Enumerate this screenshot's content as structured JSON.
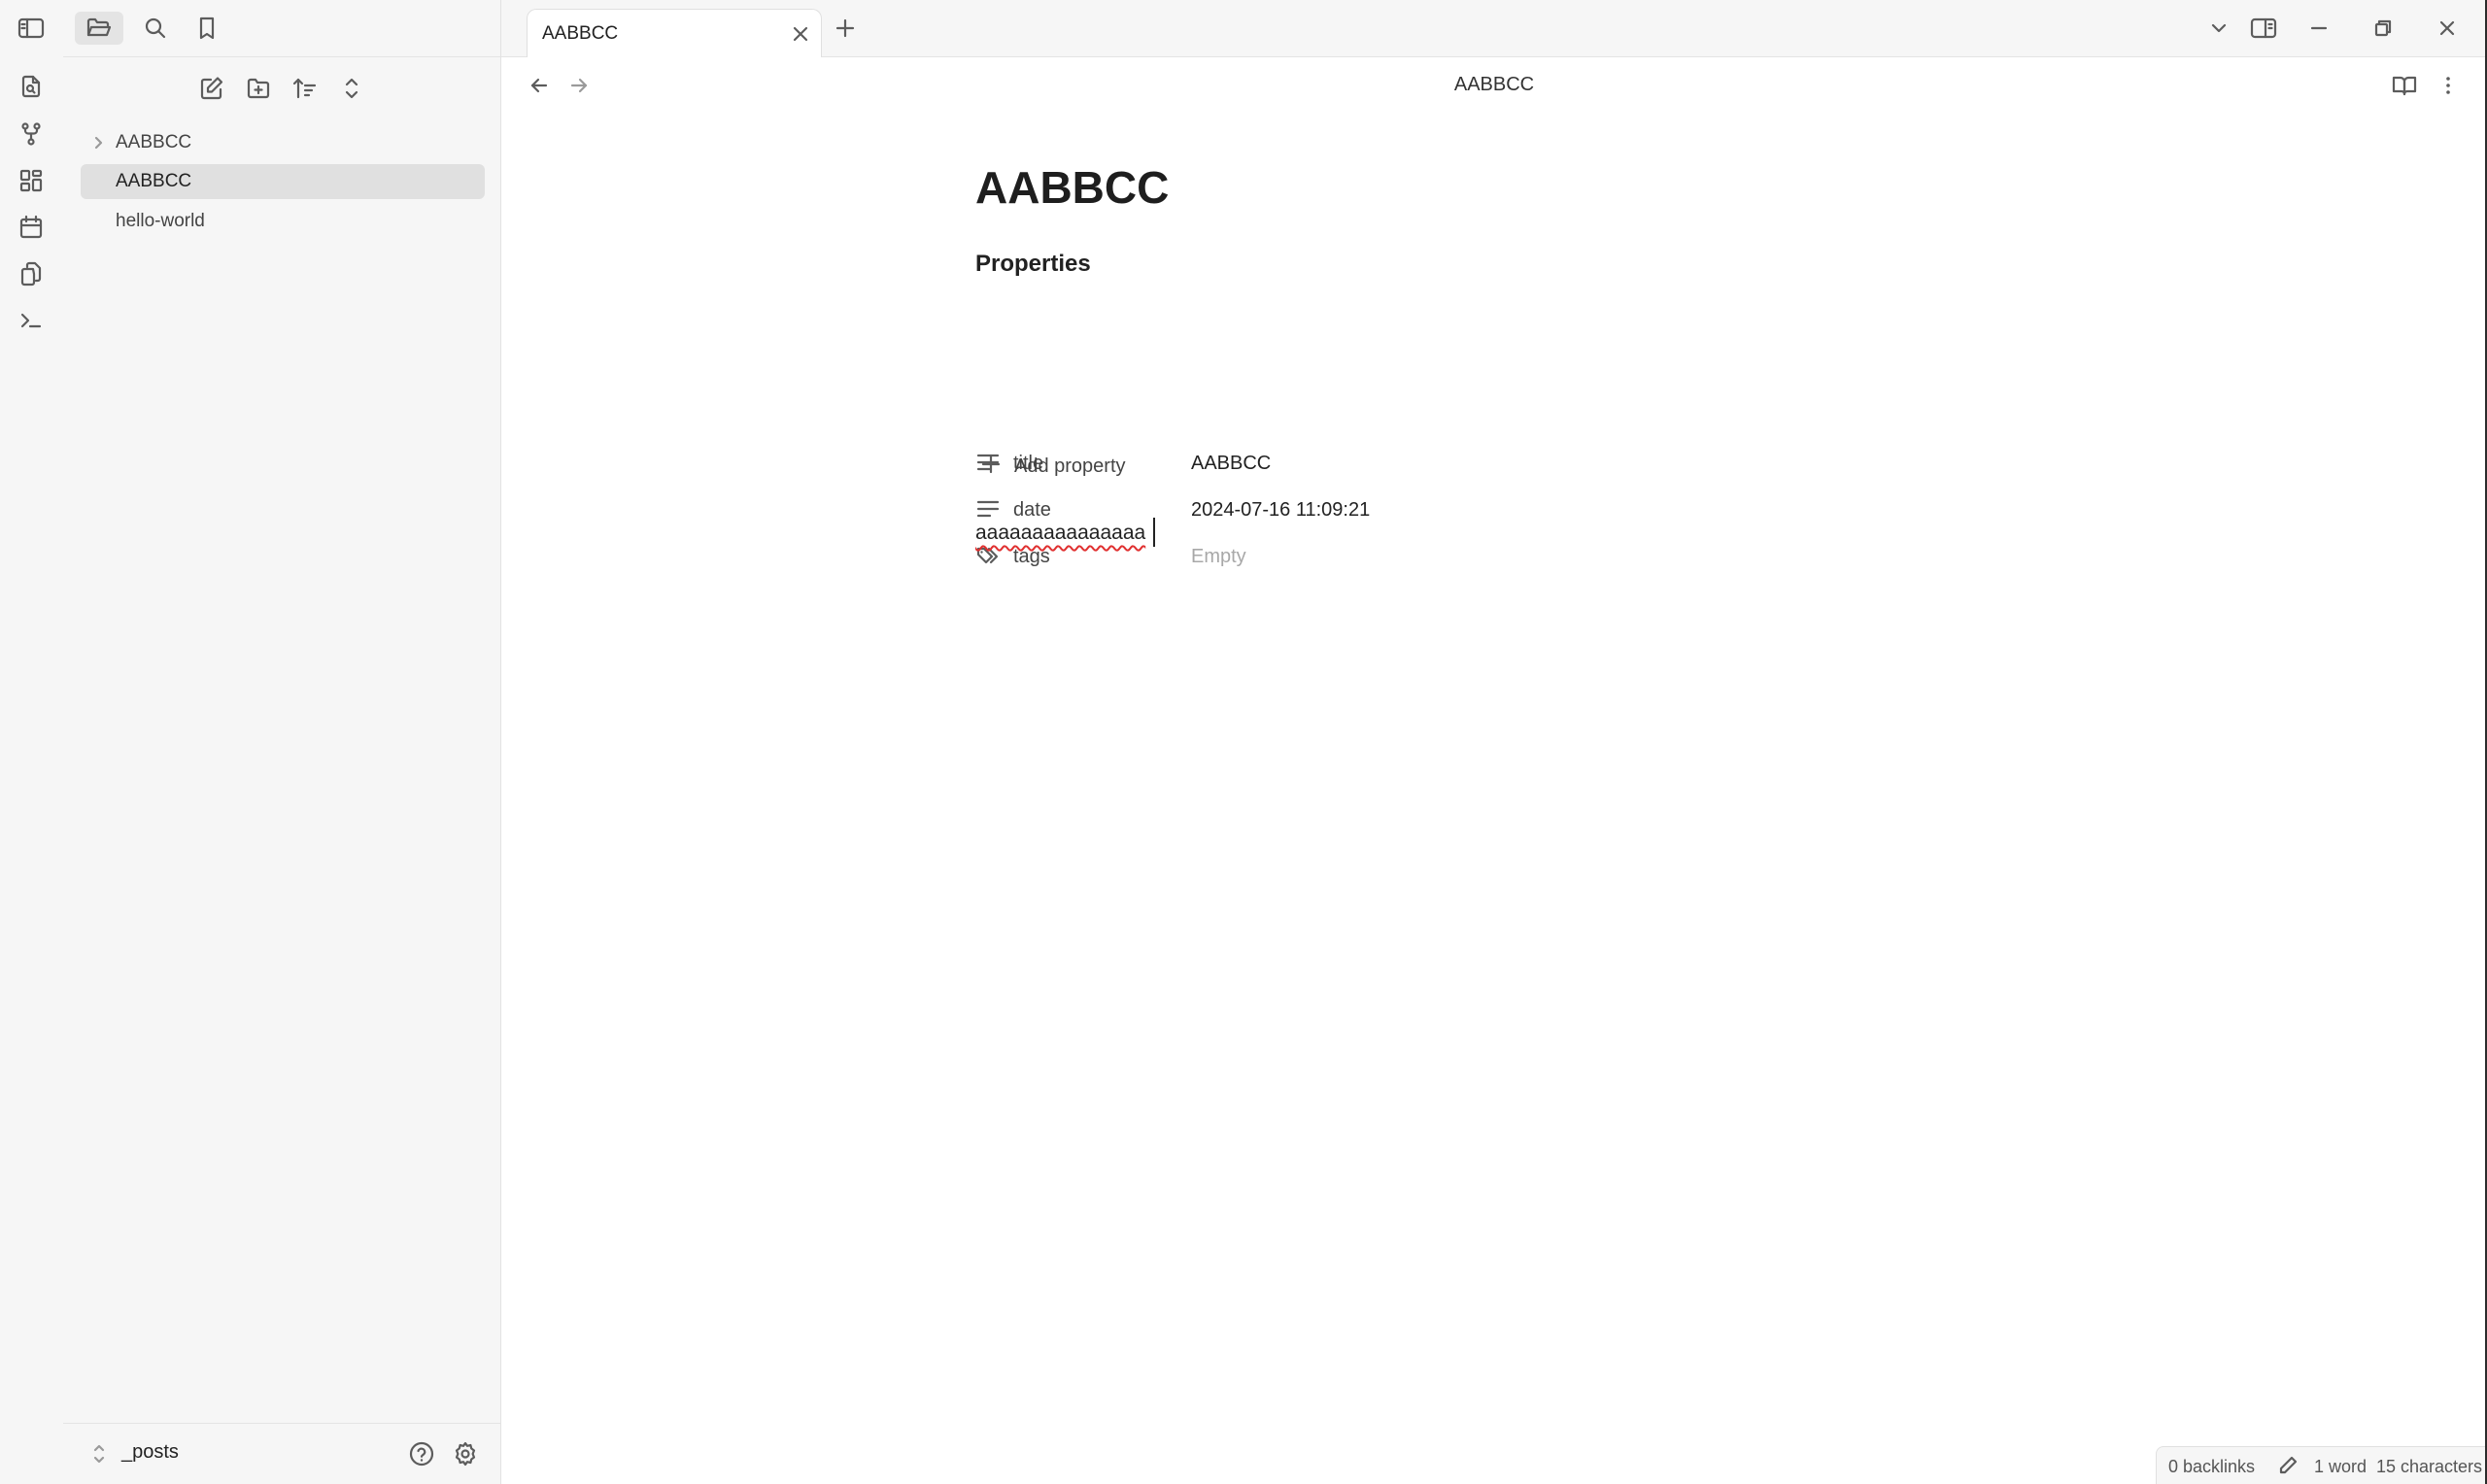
{
  "sidebar": {
    "tree": [
      {
        "label": "AABBCC",
        "kind": "folder",
        "collapsed": true
      },
      {
        "label": "AABBCC",
        "kind": "file",
        "active": true
      },
      {
        "label": "hello-world",
        "kind": "file"
      }
    ],
    "vault_name": "_posts"
  },
  "tab": {
    "title": "AABBCC"
  },
  "header": {
    "title": "AABBCC"
  },
  "editor": {
    "title": "AABBCC",
    "properties_heading": "Properties",
    "properties": [
      {
        "key": "title",
        "value": "AABBCC",
        "icon": "text-lines-icon"
      },
      {
        "key": "date",
        "value": "2024-07-16 11:09:21",
        "icon": "text-lines-icon"
      },
      {
        "key": "tags",
        "value": "Empty",
        "icon": "tags-icon",
        "empty": true
      }
    ],
    "add_property_label": "Add property",
    "body": "aaaaaaaaaaaaaaa"
  },
  "status": {
    "backlinks": "0 backlinks",
    "words": "1 word",
    "characters": "15 characters"
  },
  "colors": {
    "accent": "#e03030",
    "sidebar_bg": "#f6f6f6",
    "active_item_bg": "#e0e0e0"
  }
}
